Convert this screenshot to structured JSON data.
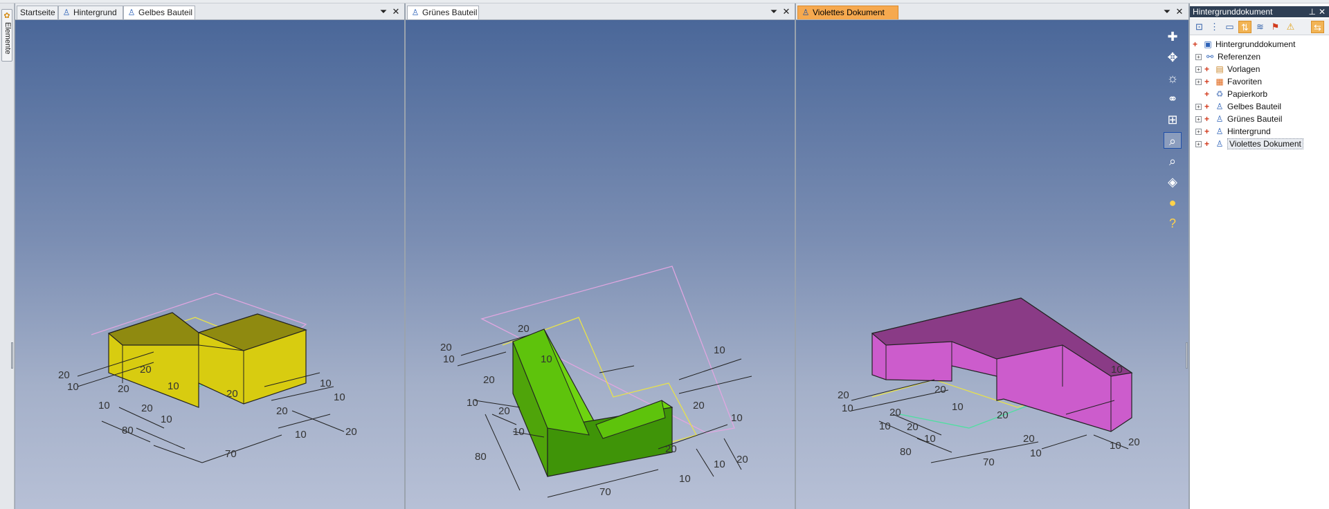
{
  "left_rail": {
    "icon": "elements-icon",
    "label": "Elemente"
  },
  "panes": [
    {
      "tabs": [
        {
          "label": "Startseite",
          "icon": ""
        },
        {
          "label": "Hintergrund",
          "icon": "part-icon"
        },
        {
          "label": "Gelbes Bauteil",
          "icon": "part-icon"
        }
      ],
      "active_tab": 2,
      "dims": [
        "20",
        "10",
        "10",
        "20",
        "20",
        "10",
        "20",
        "10",
        "80",
        "70",
        "10",
        "20",
        "20",
        "10",
        "10",
        "20"
      ],
      "colors": {
        "front": "#d8cc10",
        "side": "#bdb20b",
        "top": "#8f8a10"
      }
    },
    {
      "tabs": [
        {
          "label": "Grünes Bauteil",
          "icon": "part-icon"
        }
      ],
      "active_tab": 0,
      "dims": [
        "20",
        "10",
        "20",
        "20",
        "10",
        "10",
        "20",
        "10",
        "80",
        "70",
        "10",
        "20",
        "20",
        "10",
        "10",
        "20",
        "10"
      ],
      "colors": {
        "front": "#4fa40a",
        "side": "#3f8f08",
        "top": "#6ed410"
      }
    },
    {
      "tabs": [
        {
          "label": "Violettes Dokument",
          "icon": "part-icon"
        }
      ],
      "active_tab": 0,
      "dims": [
        "20",
        "10",
        "20",
        "20",
        "10",
        "10",
        "20",
        "20",
        "10",
        "80",
        "70",
        "10",
        "20",
        "10",
        "10",
        "20"
      ],
      "colors": {
        "front": "#cc5ccc",
        "side": "#b14bb4",
        "top": "#8a3b86"
      }
    }
  ],
  "toolbar_icons": [
    "plus-icon",
    "move-icon",
    "light-icon",
    "camera-icon",
    "layout-icon",
    "zoom-window-icon",
    "zoom-icon",
    "view-cube-icon",
    "color-icon",
    "help-icon"
  ],
  "right_panel": {
    "title": "Hintergrunddokument",
    "tree": [
      {
        "label": "Hintergrunddokument",
        "level": 0,
        "icon": "document-icon"
      },
      {
        "label": "Referenzen",
        "level": 1,
        "icon": "references-icon"
      },
      {
        "label": "Vorlagen",
        "level": 1,
        "icon": "templates-icon"
      },
      {
        "label": "Favoriten",
        "level": 1,
        "icon": "favorites-icon"
      },
      {
        "label": "Papierkorb",
        "level": 1,
        "icon": "trash-icon"
      },
      {
        "label": "Gelbes Bauteil",
        "level": 1,
        "icon": "part-icon"
      },
      {
        "label": "Grünes Bauteil",
        "level": 1,
        "icon": "part-icon"
      },
      {
        "label": "Hintergrund",
        "level": 1,
        "icon": "part-icon"
      },
      {
        "label": "Violettes Dokument",
        "level": 1,
        "icon": "part-icon"
      }
    ]
  }
}
